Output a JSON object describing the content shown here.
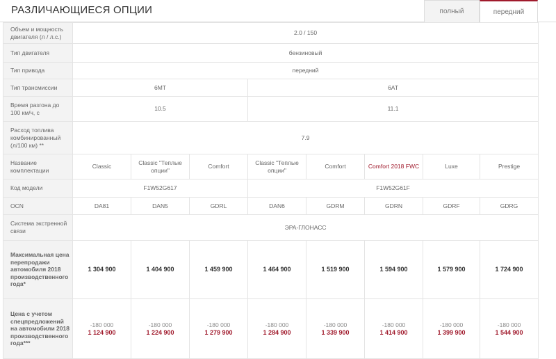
{
  "header": {
    "title": "РАЗЛИЧАЮЩИЕСЯ ОПЦИИ",
    "tabs": [
      {
        "label": "полный",
        "active": false
      },
      {
        "label": "передний",
        "active": true
      }
    ]
  },
  "colors": {
    "accent": "#a01a2c",
    "label_bg": "#f3f3f3",
    "border": "#e4e4e4"
  },
  "rows": {
    "volume": {
      "label": "Объем и мощность двигателя (л / л.с.)",
      "value": "2.0 / 150"
    },
    "engine_type": {
      "label": "Тип двигателя",
      "value": "бензиновый"
    },
    "drive": {
      "label": "Тип привода",
      "value": "передний"
    },
    "transmission": {
      "label": "Тип трансмиссии",
      "values": [
        "6MT",
        "6AT"
      ]
    },
    "acceleration": {
      "label": "Время разгона до 100 км/ч, с",
      "values": [
        "10.5",
        "11.1"
      ]
    },
    "fuel": {
      "label": "Расход топлива комбинированный (л/100 км) **",
      "value": "7.9"
    },
    "trim": {
      "label": "Название комплектации",
      "values": [
        "Classic",
        "Classic \"Теплые опции\"",
        "Comfort",
        "Classic \"Теплые опции\"",
        "Comfort",
        "Comfort 2018 FWC",
        "Luxe",
        "Prestige"
      ]
    },
    "model_code": {
      "label": "Код модели",
      "values": [
        "F1W52G617",
        "F1W52G61F"
      ]
    },
    "ocn": {
      "label": "OCN",
      "values": [
        "DA81",
        "DAN5",
        "GDRL",
        "DAN6",
        "GDRM",
        "GDRN",
        "GDRF",
        "GDRG"
      ]
    },
    "emergency": {
      "label": "Система экстренной связи",
      "value": "ЭРА-ГЛОНАСС"
    },
    "max_price": {
      "label": "Максимальная цена перепродажи автомобиля 2018 производственного года*",
      "values": [
        "1 304 900",
        "1 404 900",
        "1 459 900",
        "1 464 900",
        "1 519 900",
        "1 594 900",
        "1 579 900",
        "1 724 900"
      ]
    },
    "special_price": {
      "label": "Цена с учетом спецпредложений на автомобили 2018 производственного года***",
      "discounts": [
        "-180 000",
        "-180 000",
        "-180 000",
        "-180 000",
        "-180 000",
        "-180 000",
        "-180 000",
        "-180 000"
      ],
      "finals": [
        "1 124 900",
        "1 224 900",
        "1 279 900",
        "1 284 900",
        "1 339 900",
        "1 414 900",
        "1 399 900",
        "1 544 900"
      ]
    }
  }
}
